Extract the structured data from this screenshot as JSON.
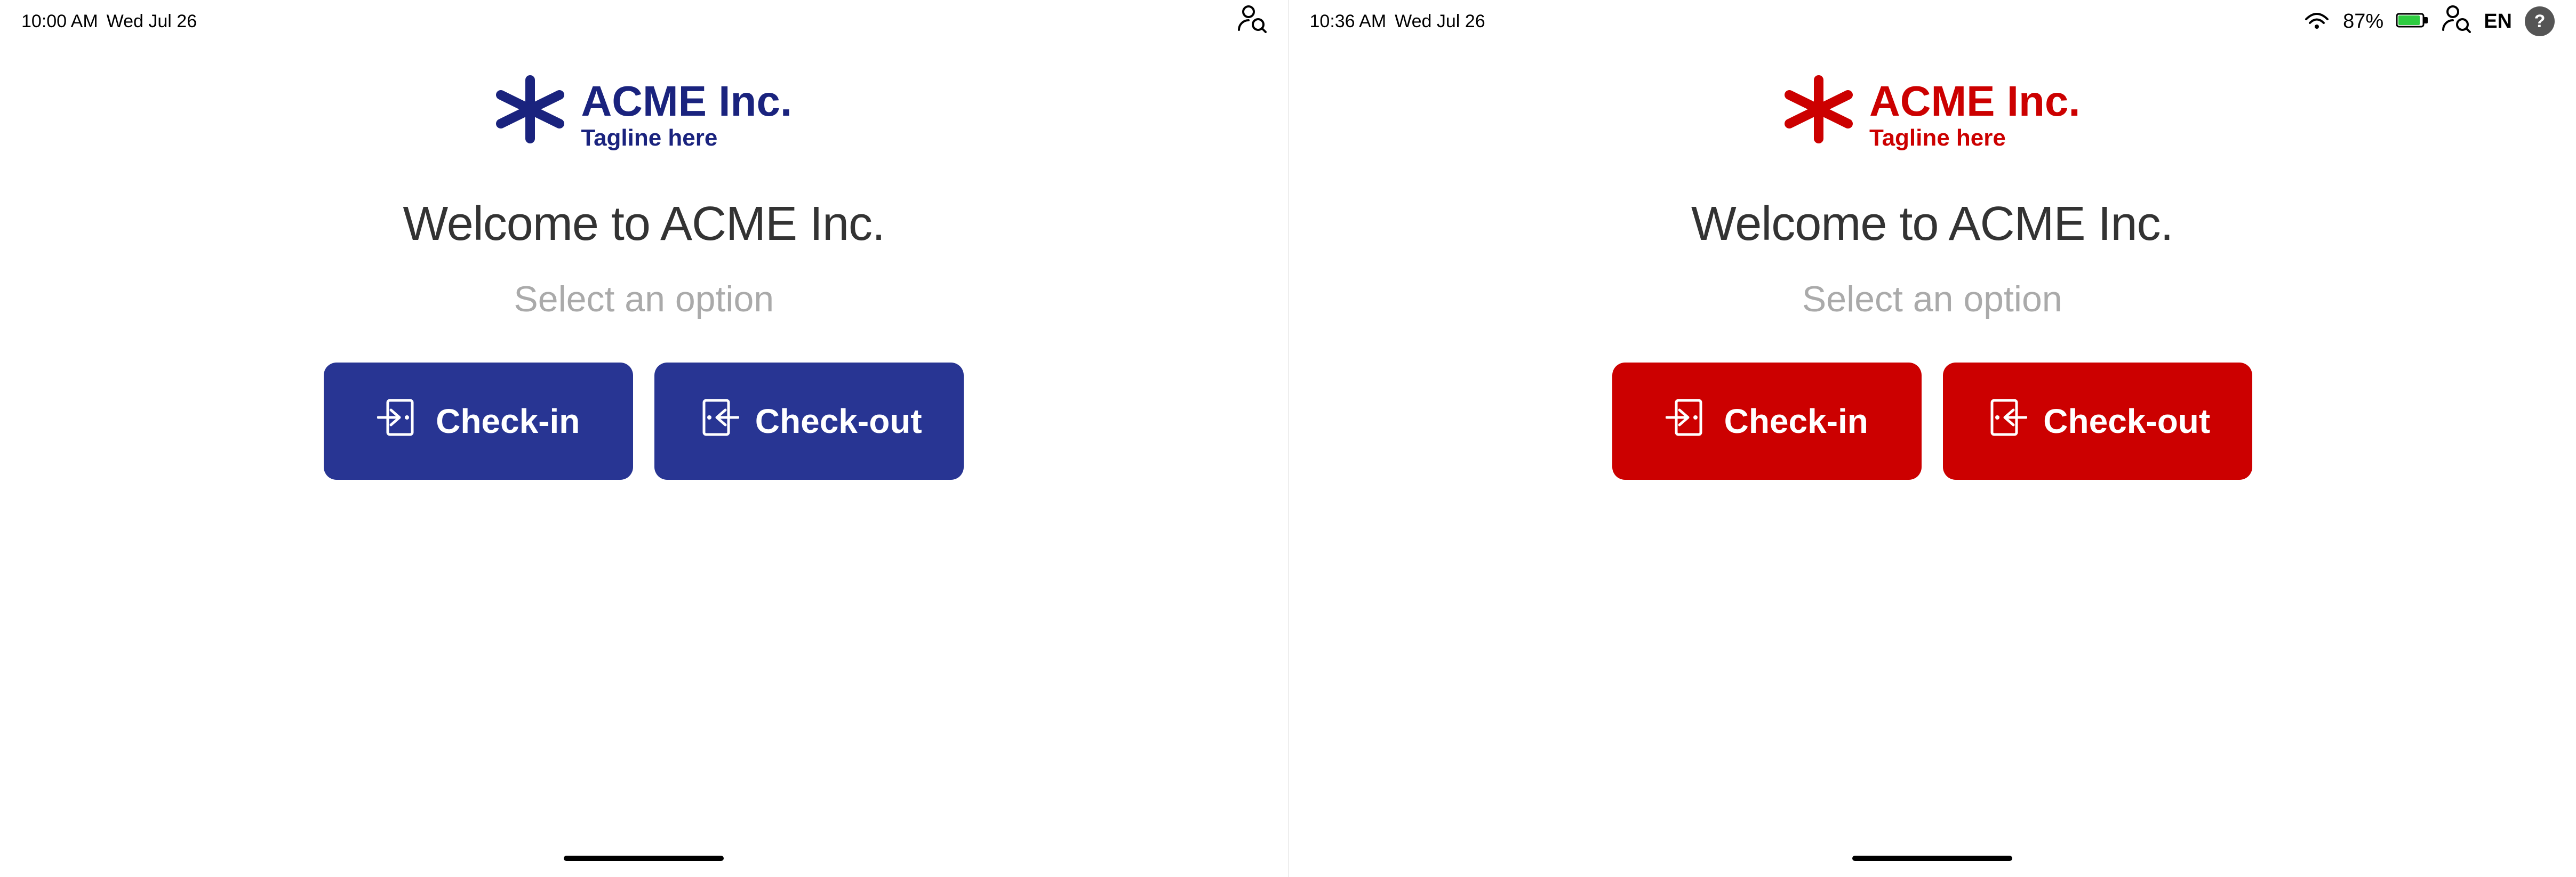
{
  "left_screen": {
    "status": {
      "time": "10:00 AM",
      "date": "Wed Jul 26",
      "person_icon": "👤",
      "lang": "",
      "help": ""
    },
    "logo": {
      "asterisk": "✳",
      "company_name": "ACME Inc.",
      "tagline": "Tagline here",
      "color_class": "blue"
    },
    "welcome": "Welcome to ACME Inc.",
    "select_option": "Select an option",
    "buttons": [
      {
        "label": "Check-in",
        "icon": "checkin",
        "color": "blue"
      },
      {
        "label": "Check-out",
        "icon": "checkout",
        "color": "blue"
      }
    ]
  },
  "right_screen": {
    "status": {
      "time": "10:36 AM",
      "date": "Wed Jul 26",
      "battery": "87%",
      "person_icon": "👤",
      "lang": "EN",
      "help": "?"
    },
    "logo": {
      "asterisk": "✳",
      "company_name": "ACME Inc.",
      "tagline": "Tagline here",
      "color_class": "red"
    },
    "welcome": "Welcome to ACME Inc.",
    "select_option": "Select an option",
    "buttons": [
      {
        "label": "Check-in",
        "icon": "checkin",
        "color": "red"
      },
      {
        "label": "Check-out",
        "icon": "checkout",
        "color": "red"
      }
    ]
  },
  "icons": {
    "checkin_svg": "→🚪",
    "checkout_svg": "←🚪"
  }
}
